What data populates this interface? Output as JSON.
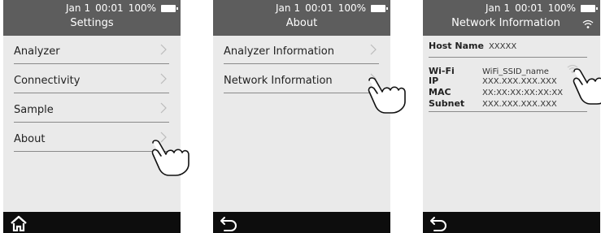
{
  "status": {
    "date": "Jan",
    "day": "1",
    "time": "00:01",
    "battery": "100%"
  },
  "screens": [
    {
      "title": "Settings",
      "items": [
        {
          "label": "Analyzer"
        },
        {
          "label": "Connectivity"
        },
        {
          "label": "Sample"
        },
        {
          "label": "About"
        }
      ],
      "bottom_icon": "home-icon"
    },
    {
      "title": "About",
      "items": [
        {
          "label": "Analyzer Information"
        },
        {
          "label": "Network Information"
        }
      ],
      "bottom_icon": "back-icon"
    },
    {
      "title": "Network Information",
      "host_name_label": "Host Name",
      "host_name_value": "XXXXX",
      "wifi_label": "Wi-Fi",
      "wifi_value": "WiFi_SSID_name",
      "ip_label": "IP",
      "ip_value": "XXX.XXX.XXX.XXX",
      "mac_label": "MAC",
      "mac_value": "XX:XX:XX:XX:XX:XX",
      "subnet_label": "Subnet",
      "subnet_value": "XXX.XXX.XXX.XXX",
      "bottom_icon": "back-icon"
    }
  ],
  "colors": {
    "statusbar": "#5d5d5d",
    "background": "#eaeaea",
    "bottombar": "#0d0d0d",
    "divider": "#8a8a8a"
  }
}
